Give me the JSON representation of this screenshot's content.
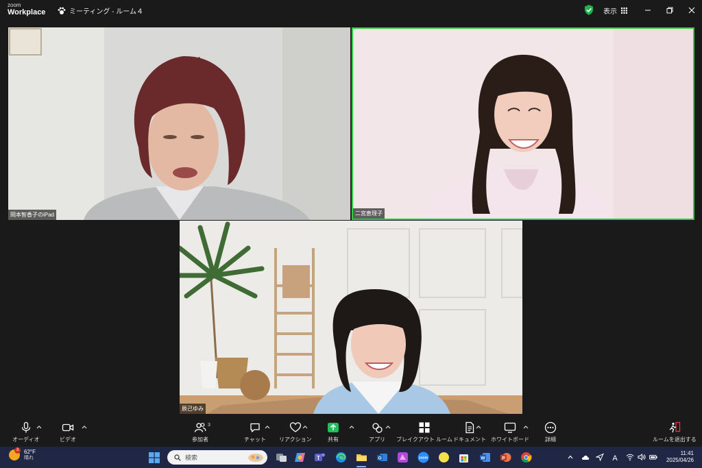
{
  "window": {
    "logo_line1": "zoom",
    "logo_line2": "Workplace",
    "meeting_title": "ミーティング - ルーム４",
    "view_label": "表示"
  },
  "participants": [
    {
      "name": "岡本智香子のiPad"
    },
    {
      "name": "二宮恵理子"
    },
    {
      "name": "辰己ゆみ"
    }
  ],
  "toolbar": {
    "audio": "オーディオ",
    "video": "ビデオ",
    "participants": "参加者",
    "participants_count": "3",
    "chat": "チャット",
    "reactions": "リアクション",
    "share": "共有",
    "apps": "アプリ",
    "breakout": "ブレイクアウト ルーム",
    "docs": "ドキュメント",
    "whiteboard": "ホワイトボード",
    "more": "詳細",
    "leave": "ルームを退出する"
  },
  "taskbar": {
    "weather_temp": "62°F",
    "weather_cond": "晴れ",
    "weather_badge": "3",
    "search_placeholder": "検索",
    "time": "11:41",
    "date": "2025/04/26"
  },
  "colors": {
    "active_speaker_border": "#2ecc40",
    "share_green": "#1fbf5b",
    "taskbar_bg": "#202744"
  }
}
